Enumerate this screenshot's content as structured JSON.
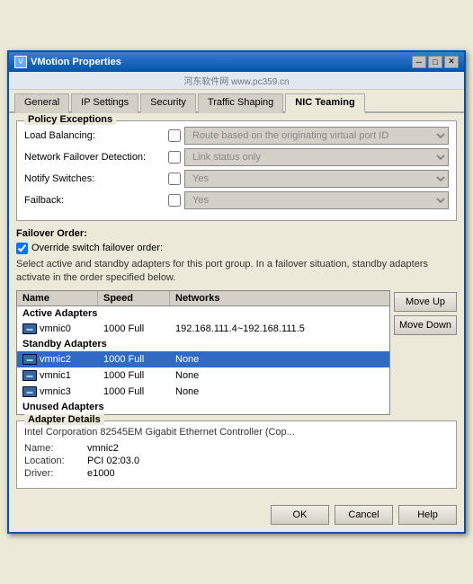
{
  "window": {
    "title": "VMotion Properties",
    "close_label": "✕",
    "minimize_label": "─",
    "maximize_label": "□"
  },
  "watermark": "河东软件网  www.pc359.cn",
  "tabs": [
    {
      "label": "General",
      "active": false
    },
    {
      "label": "IP Settings",
      "active": false
    },
    {
      "label": "Security",
      "active": false
    },
    {
      "label": "Traffic Shaping",
      "active": false
    },
    {
      "label": "NIC Teaming",
      "active": true
    }
  ],
  "policy_exceptions": {
    "title": "Policy Exceptions",
    "rows": [
      {
        "label": "Load Balancing:",
        "checked": false,
        "value": "Route based on the originating virtual port ID"
      },
      {
        "label": "Network Failover Detection:",
        "checked": false,
        "value": "Link status only"
      },
      {
        "label": "Notify Switches:",
        "checked": false,
        "value": "Yes"
      },
      {
        "label": "Failback:",
        "checked": false,
        "value": "Yes"
      }
    ]
  },
  "failover_order": {
    "label": "Failover Order:",
    "override_checked": true,
    "override_label": "Override switch failover order:",
    "info_text": "Select active and standby adapters for this port group.  In a failover situation, standby adapters activate  in the order specified below.",
    "table_headers": [
      "Name",
      "Speed",
      "Networks"
    ],
    "sections": [
      {
        "section_label": "Active Adapters",
        "rows": [
          {
            "name": "vmnic0",
            "speed": "1000 Full",
            "networks": "192.168.111.4~192.168.111.5",
            "selected": false
          }
        ]
      },
      {
        "section_label": "Standby Adapters",
        "rows": [
          {
            "name": "vmnic2",
            "speed": "1000 Full",
            "networks": "None",
            "selected": true
          },
          {
            "name": "vmnic1",
            "speed": "1000 Full",
            "networks": "None",
            "selected": false
          },
          {
            "name": "vmnic3",
            "speed": "1000 Full",
            "networks": "None",
            "selected": false
          }
        ]
      },
      {
        "section_label": "Unused Adapters",
        "rows": []
      }
    ],
    "move_up": "Move Up",
    "move_down": "Move Down"
  },
  "adapter_details": {
    "title": "Adapter Details",
    "description": "Intel Corporation 82545EM Gigabit Ethernet Controller (Cop...",
    "fields": [
      {
        "key": "Name:",
        "value": "vmnic2"
      },
      {
        "key": "Location:",
        "value": "PCI 02:03.0"
      },
      {
        "key": "Driver:",
        "value": "e1000"
      }
    ]
  },
  "buttons": {
    "ok": "OK",
    "cancel": "Cancel",
    "help": "Help"
  }
}
